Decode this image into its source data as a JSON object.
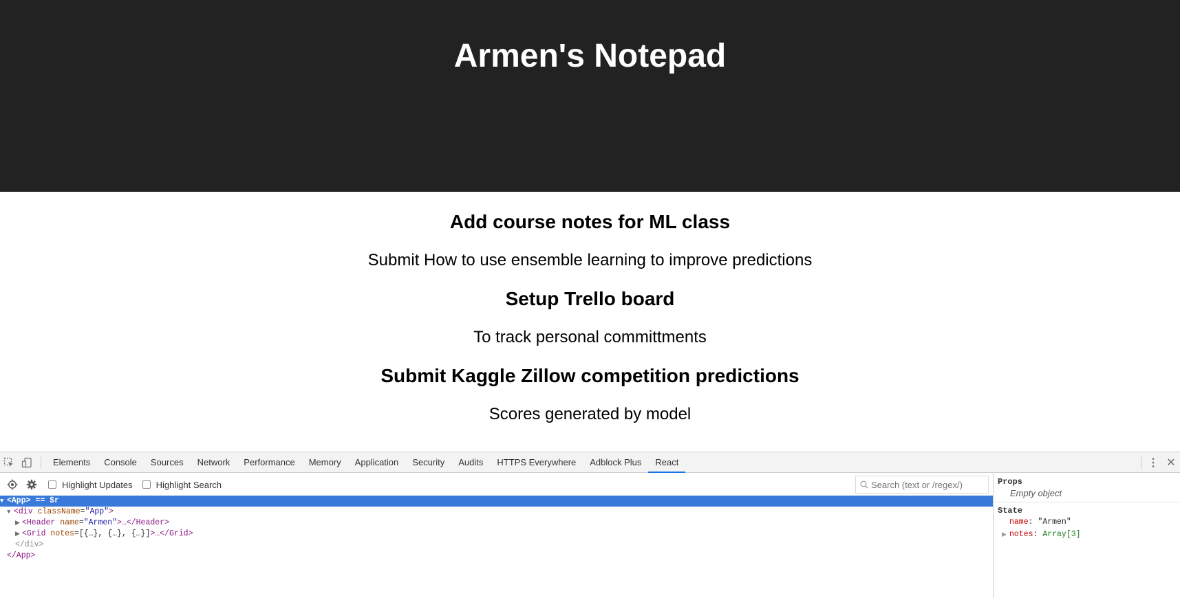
{
  "app": {
    "title": "Armen's Notepad",
    "notes": [
      {
        "title": "Add course notes for ML class",
        "body": "Submit How to use ensemble learning to improve predictions"
      },
      {
        "title": "Setup Trello board",
        "body": "To track personal committments"
      },
      {
        "title": "Submit Kaggle Zillow competition predictions",
        "body": "Scores generated by model"
      }
    ]
  },
  "devtools": {
    "icons": {
      "inspect": "inspect-element-icon",
      "device": "device-toolbar-icon",
      "more": "kebab-menu-icon",
      "close": "close-icon"
    },
    "tabs": [
      {
        "label": "Elements",
        "active": false
      },
      {
        "label": "Console",
        "active": false
      },
      {
        "label": "Sources",
        "active": false
      },
      {
        "label": "Network",
        "active": false
      },
      {
        "label": "Performance",
        "active": false
      },
      {
        "label": "Memory",
        "active": false
      },
      {
        "label": "Application",
        "active": false
      },
      {
        "label": "Security",
        "active": false
      },
      {
        "label": "Audits",
        "active": false
      },
      {
        "label": "HTTPS Everywhere",
        "active": false
      },
      {
        "label": "Adblock Plus",
        "active": false
      },
      {
        "label": "React",
        "active": true
      }
    ],
    "toolbar": {
      "highlight_updates": "Highlight Updates",
      "highlight_search": "Highlight Search",
      "search_placeholder": "Search (text or /regex/)"
    },
    "tree": {
      "row0": {
        "open_tag": "<App>",
        "suffix": " == $r"
      },
      "row1": {
        "tag_open": "<div",
        "attr": "className",
        "value": "\"App\"",
        "close": ">"
      },
      "row2": {
        "tag_open": "<Header",
        "attr": "name",
        "value": "\"Armen\"",
        "ellipsis": ">…</",
        "tag_close": "Header",
        "end": ">"
      },
      "row3": {
        "tag_open": "<Grid",
        "attr": "notes",
        "value": "=[{…}, {…}, {…}]",
        "ellipsis": ">…</",
        "tag_close": "Grid",
        "end": ">"
      },
      "row4": {
        "text": "</div>"
      },
      "row5": {
        "text": "</App>"
      }
    },
    "side": {
      "props_heading": "Props",
      "props_empty": "Empty object",
      "state_heading": "State",
      "state": [
        {
          "key": "name",
          "value": "\"Armen\""
        },
        {
          "key": "notes",
          "value": "Array[3]"
        }
      ]
    },
    "colors": {
      "accent": "#1a73e8",
      "selected_row": "#3879d9",
      "header_bg": "#222222"
    }
  }
}
